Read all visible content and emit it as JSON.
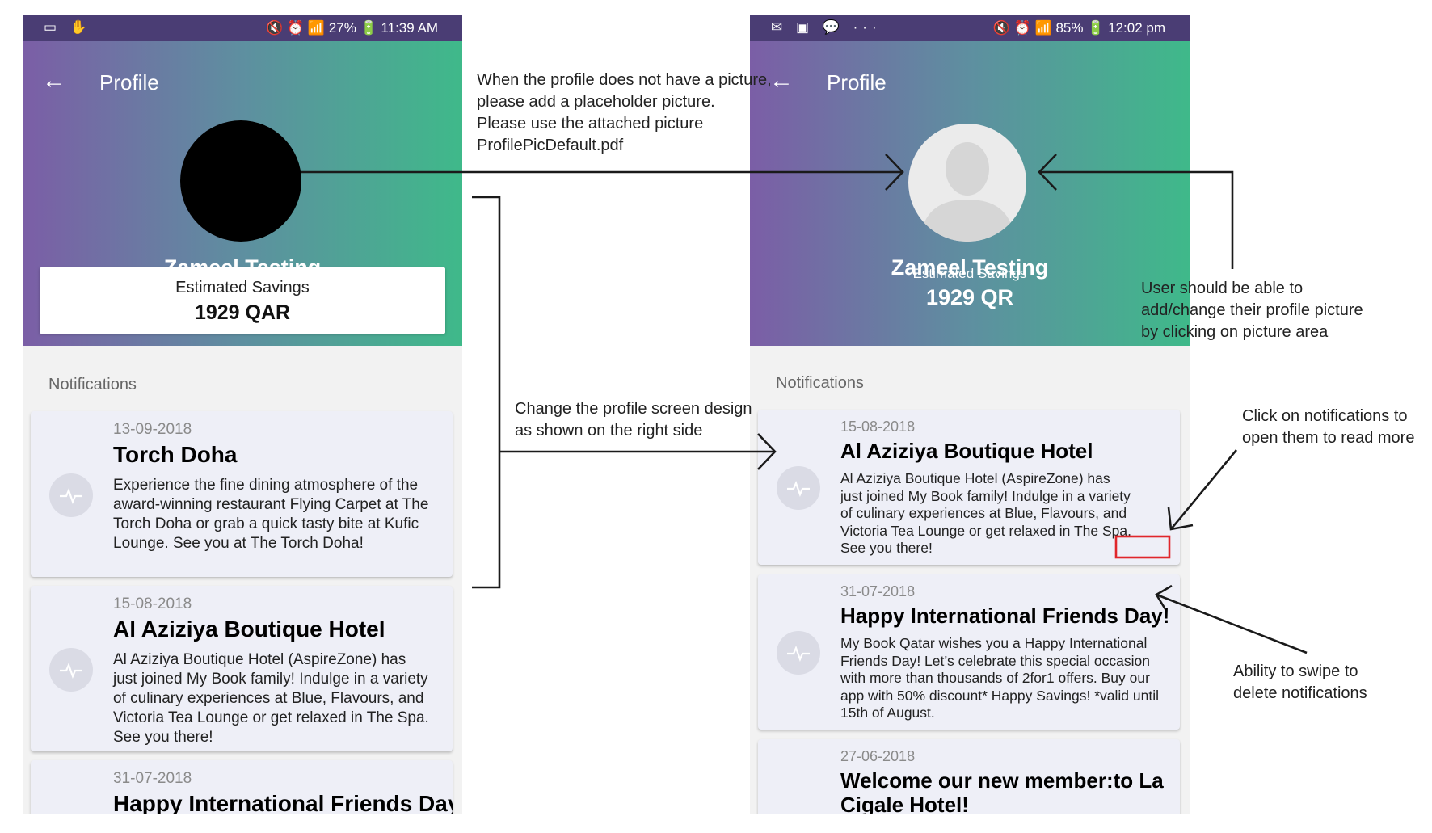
{
  "left_phone": {
    "status_left": "▭ ✋",
    "status_right": "🔇 ⏰ 📶 27% 🔋 11:39 AM",
    "title": "Profile",
    "name": "Zameel Testing",
    "savings_label": "Estimated Savings",
    "savings_value": "1929 QAR",
    "notifications_label": "Notifications",
    "notifications": [
      {
        "date": "13-09-2018",
        "title": "Torch Doha",
        "body": "Experience the fine dining atmosphere of the award-winning restaurant Flying Carpet at The Torch Doha or grab a quick tasty bite at Kufic Lounge. See you at The Torch Doha!"
      },
      {
        "date": "15-08-2018",
        "title": "Al Aziziya Boutique Hotel",
        "body": "Al Aziziya Boutique Hotel (AspireZone) has just joined My Book family! Indulge in a variety of culinary experiences at Blue, Flavours, and Victoria Tea Lounge or get relaxed in The Spa. See you there!"
      },
      {
        "date": "31-07-2018",
        "title": "Happy International Friends Day!",
        "body": ""
      }
    ]
  },
  "right_phone": {
    "status_left": "✉ ▣ 💬 ···",
    "status_right": "🔇 ⏰ 📶 85% 🔋 12:02 pm",
    "title": "Profile",
    "name": "Zameel Testing",
    "savings_label": "Estimated  Savings",
    "savings_value": "1929 QR",
    "notifications_label": "Notifications",
    "notifications": [
      {
        "date": "15-08-2018",
        "title": "Al Aziziya Boutique Hotel",
        "body": "Al Aziziya Boutique Hotel (AspireZone) has just joined My Book family! Indulge in a variety of culinary experiences at Blue, Flavours, and Victoria Tea Lounge or get relaxed in The Spa. See you there!"
      },
      {
        "date": "31-07-2018",
        "title": "Happy International Friends Day!",
        "body": "My Book Qatar wishes you a Happy International Friends Day! Let’s celebrate this special occasion with more than thousands of 2for1 offers. Buy our app with 50% discount* Happy Savings! *valid until 15th of August."
      },
      {
        "date": "27-06-2018",
        "title": "Welcome our new member:to La Cigale Hotel!",
        "body": ""
      }
    ]
  },
  "annotations": {
    "placeholder_note": [
      "When the profile does not have a picture,",
      "please add a placeholder picture.",
      "Please use the attached picture",
      "ProfilePicDefault.pdf"
    ],
    "design_note": [
      "Change the profile screen design",
      "as shown on the right side"
    ],
    "change_picture_note": [
      "User should be able to",
      "add/change their profile picture",
      "by clicking on picture area"
    ],
    "click_note": [
      "Click on notifications to",
      "open them to read more"
    ],
    "swipe_note": [
      "Ability to swipe to",
      "delete notifications"
    ]
  },
  "colors": {
    "header_start": "#7b5ea6",
    "header_end": "#3fb98a",
    "status_bar": "#4a3d74",
    "card_bg": "#eeeff7",
    "highlight_box": "#e0262b"
  },
  "icons": {
    "back": "back-arrow-icon",
    "notification": "pulse-icon",
    "placeholder": "person-placeholder-icon"
  }
}
